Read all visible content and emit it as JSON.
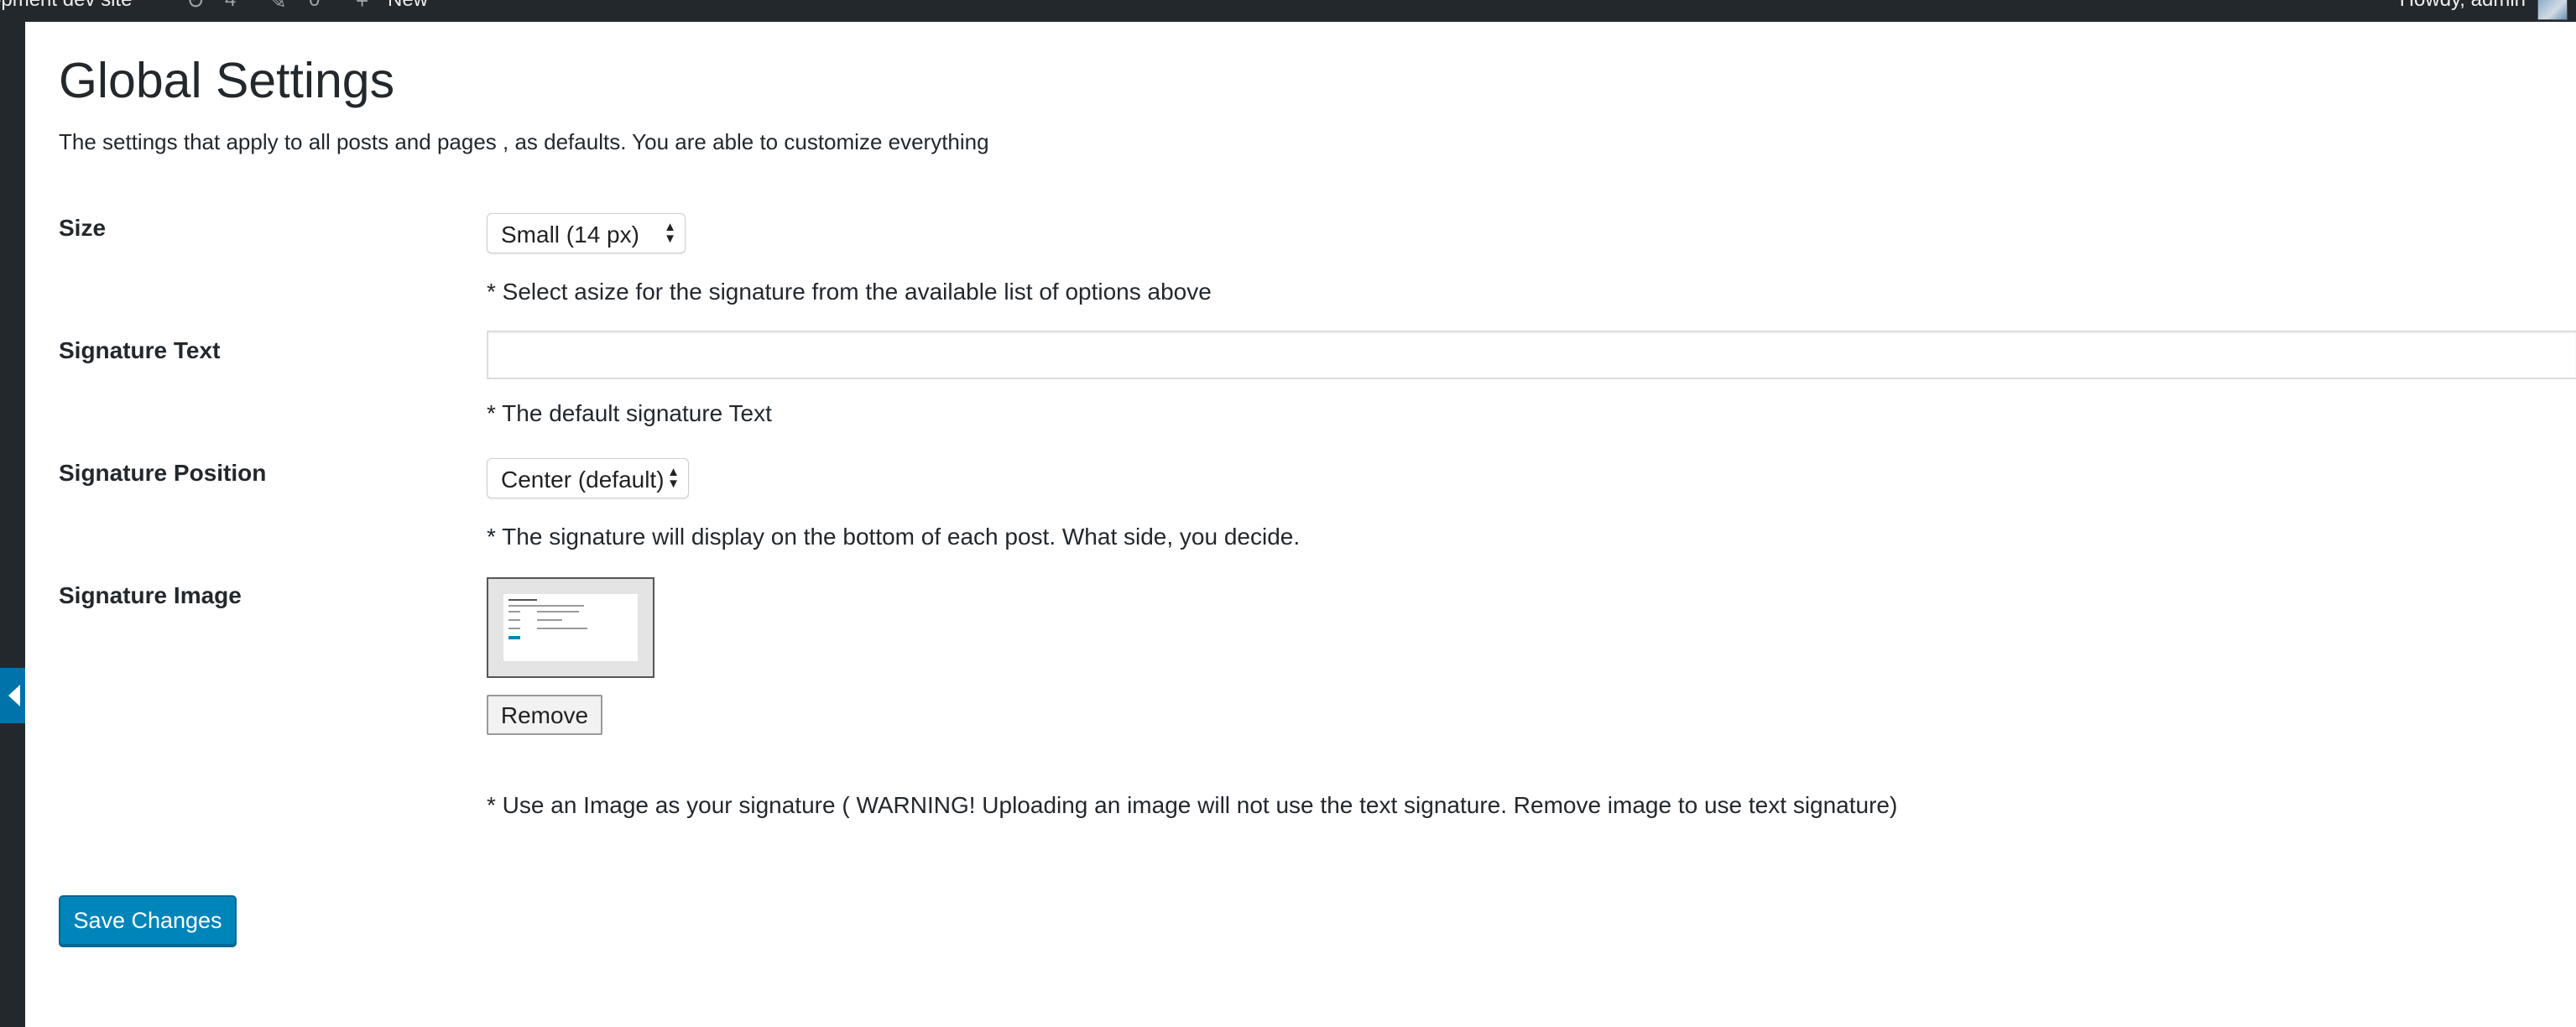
{
  "admin_bar": {
    "site_name": "opment dev site",
    "updates_count": "4",
    "comments_count": "0",
    "new_label": "New",
    "howdy": "Howdy, admin"
  },
  "page": {
    "title": "Global Settings",
    "description": "The settings that apply to all posts and pages , as defaults. You are able to customize everything"
  },
  "fields": {
    "size": {
      "label": "Size",
      "selected": "Small (14 px)",
      "help": "* Select asize for the signature from the available list of options above"
    },
    "signature_text": {
      "label": "Signature Text",
      "value": "",
      "help": "* The default signature Text"
    },
    "signature_position": {
      "label": "Signature Position",
      "selected": "Center (default)",
      "help": "* The signature will display on the bottom of each post. What side, you decide."
    },
    "signature_image": {
      "label": "Signature Image",
      "remove_label": "Remove",
      "help": "* Use an Image as your signature ( WARNING! Uploading an image will not use the text signature. Remove image to use text signature)"
    }
  },
  "actions": {
    "save_label": "Save Changes"
  },
  "colors": {
    "admin_bar": "#23282d",
    "primary_button": "#0085ba",
    "collapse_tab": "#0073aa"
  }
}
